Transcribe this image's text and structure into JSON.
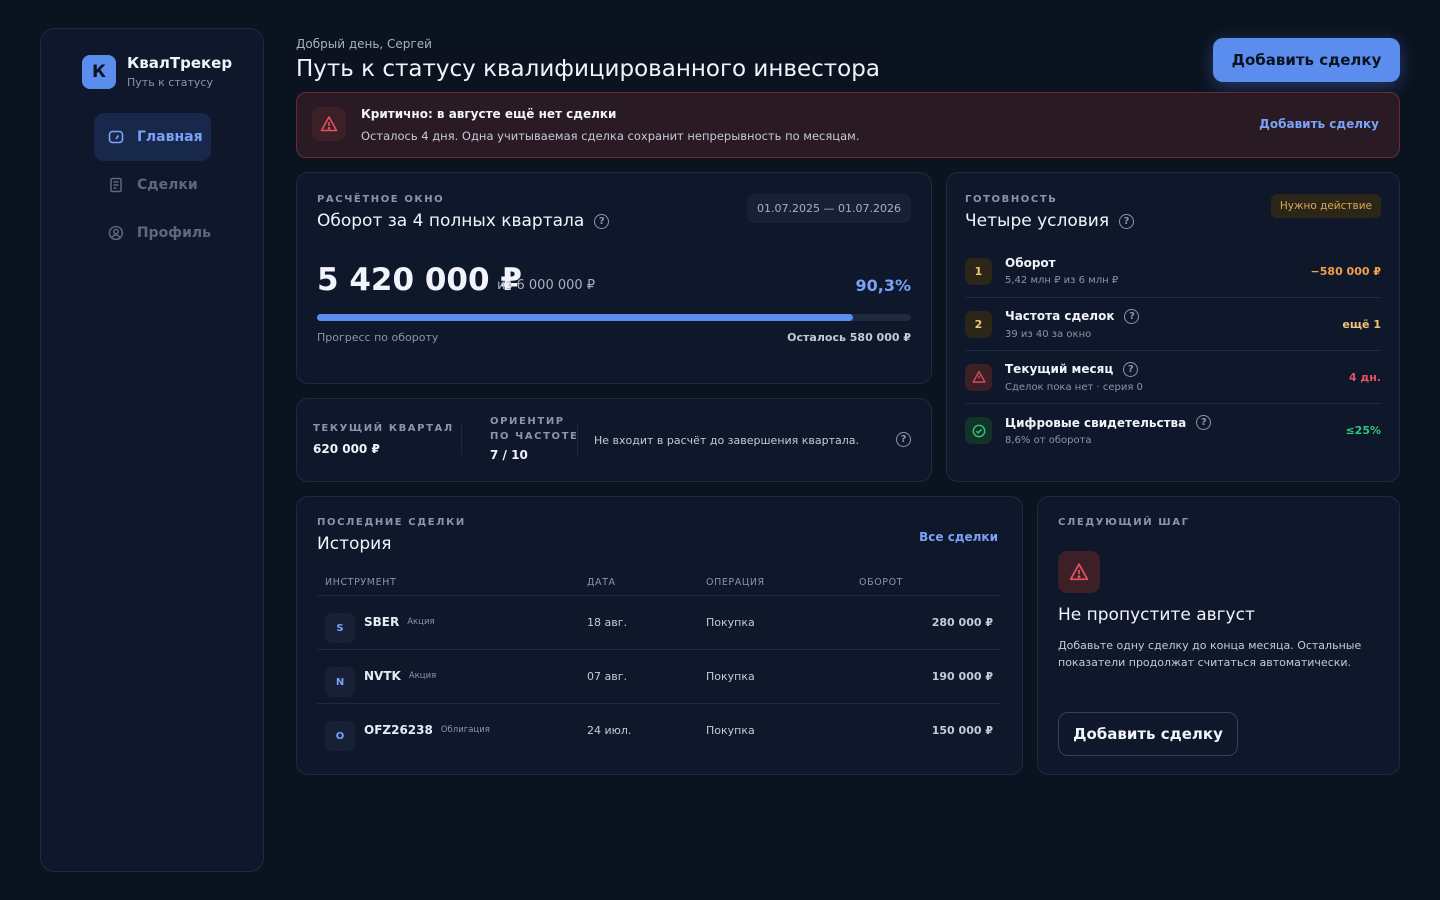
{
  "brand": {
    "logo_letter": "К",
    "title": "КвалТрекер",
    "subtitle": "Путь к статусу"
  },
  "nav": [
    {
      "label": "Главная",
      "icon": "gauge-icon",
      "active": true
    },
    {
      "label": "Сделки",
      "icon": "document-icon",
      "active": false
    },
    {
      "label": "Профиль",
      "icon": "user-icon",
      "active": false
    }
  ],
  "header": {
    "greeting": "Добрый день, Сергей",
    "title": "Путь к статусу квалифицированного инвестора",
    "add_deal_label": "Добавить сделку"
  },
  "alert": {
    "title": "Критично: в августе ещё нет сделки",
    "text": "Осталось 4 дня. Одна учитываемая сделка сохранит непрерывность по месяцам.",
    "link": "Добавить сделку",
    "color": "#e0525f"
  },
  "window": {
    "eyebrow": "РАСЧЁТНОЕ ОКНО",
    "title": "Оборот за 4 полных квартала",
    "date_range": "01.07.2025 — 01.07.2026",
    "amount": "5 420 000 ₽",
    "of_total": "из 6 000 000 ₽",
    "percent": "90,3%",
    "progress_fraction": 0.903,
    "progress_label": "Прогресс по обороту",
    "remaining": "Осталось 580 000 ₽"
  },
  "quarter": {
    "current_label": "ТЕКУЩИЙ КВАРТАЛ",
    "current_value": "620 000 ₽",
    "freq_label_1": "ОРИЕНТИР",
    "freq_label_2": "ПО ЧАСТОТЕ",
    "freq_value": "7 / 10",
    "note": "Не входит в расчёт до завершения квартала."
  },
  "conditions": {
    "eyebrow": "ГОТОВНОСТЬ",
    "title": "Четыре условия",
    "badge": "Нужно действие",
    "items": [
      {
        "badge": "1",
        "name": "Оборот",
        "sub": "5,42 млн ₽ из 6 млн ₽",
        "value": "−580 000 ₽",
        "value_color": "#f0a04b"
      },
      {
        "badge": "2",
        "name": "Частота сделок",
        "sub": "39 из 40 за окно",
        "value": "ещё 1",
        "value_color": "#f0c674"
      },
      {
        "badge": "warning-icon",
        "name": "Текущий месяц",
        "sub": "Сделок пока нет · серия 0",
        "value": "4 дн.",
        "value_color": "#e0525f"
      },
      {
        "badge": "check-icon",
        "name": "Цифровые свидетельства",
        "sub": "8,6% от оборота",
        "value": "≤25%",
        "value_color": "#34c47c"
      }
    ]
  },
  "history": {
    "eyebrow": "ПОСЛЕДНИЕ СДЕЛКИ",
    "title": "История",
    "link": "Все сделки",
    "columns": [
      "ИНСТРУМЕНТ",
      "ДАТА",
      "ОПЕРАЦИЯ",
      "ОБОРОТ"
    ],
    "rows": [
      {
        "avatar": "S",
        "ticker": "SBER",
        "type": "Акция",
        "date": "18 авг.",
        "op": "Покупка",
        "amount": "280 000 ₽"
      },
      {
        "avatar": "N",
        "ticker": "NVTK",
        "type": "Акция",
        "date": "07 авг.",
        "op": "Покупка",
        "amount": "190 000 ₽"
      },
      {
        "avatar": "O",
        "ticker": "OFZ26238",
        "type": "Облигация",
        "date": "24 июл.",
        "op": "Покупка",
        "amount": "150 000 ₽"
      }
    ]
  },
  "next": {
    "eyebrow": "СЛЕДУЮЩИЙ ШАГ",
    "title": "Не пропустите август",
    "text": "Добавьте одну сделку до конца месяца. Остальные показатели продолжат считаться автоматически.",
    "button": "Добавить сделку"
  },
  "colors": {
    "accent": "#5b8def",
    "background": "#0b1220",
    "card": "#0f172a",
    "danger": "#e0525f",
    "success": "#34c47c"
  }
}
